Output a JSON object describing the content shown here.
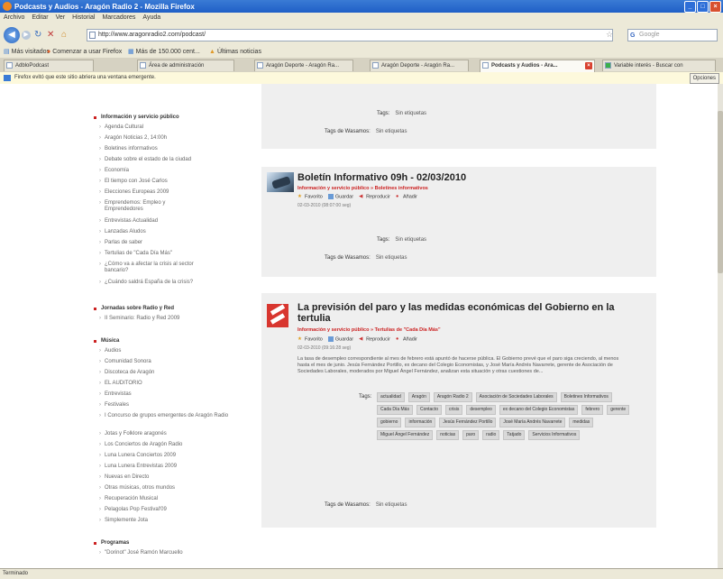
{
  "window": {
    "title": "Podcasts y Audios - Aragón Radio 2 - Mozilla Firefox"
  },
  "menubar": {
    "items": [
      "Archivo",
      "Editar",
      "Ver",
      "Historial",
      "Marcadores",
      "Ayuda"
    ]
  },
  "navbar": {
    "url": "http://www.aragonradio2.com/podcast/",
    "search_placeholder": "Google"
  },
  "bookmarks": {
    "items": [
      "Más visitados",
      "Comenzar a usar Firefox",
      "Más de 150.000 cent...",
      "Últimas noticias"
    ]
  },
  "tabs": [
    {
      "label": "AdbloPodcast"
    },
    {
      "label": "Área de administración"
    },
    {
      "label": "Aragón Deporte - Aragón Ra..."
    },
    {
      "label": "Aragón Deporte - Aragón Ra..."
    },
    {
      "label": "Podcasts y Audios - Ara...",
      "active": true
    },
    {
      "label": "Variable interés - Buscar con"
    }
  ],
  "infobar": {
    "message": "Firefox evitó que este sitio abriera una ventana emergente.",
    "button": "Opciones"
  },
  "sidebar": {
    "sections": [
      {
        "title": "Información y servicio público",
        "items": [
          "Agenda Cultural",
          "Aragón Noticias 2, 14:00h",
          "Boletines informativos",
          "Debate sobre el estado de la ciudad",
          "Economía",
          "El tiempo con José Carlos",
          "Elecciones Europeas 2009",
          "Emprendemos: Empleo y Emprendedores",
          "Entrevistas Actualidad",
          "Lanzadas Aludos",
          "Parlas de saber",
          "Tertulias de \"Cada Día Más\"",
          "¿Cómo va a afectar la crisis al sector bancario?",
          "¿Cuándo saldrá España de la crisis?"
        ]
      },
      {
        "title": "Jornadas sobre Radio y Red",
        "items": [
          "II Seminario: Radio y Red 2009"
        ]
      },
      {
        "title": "Música",
        "items": [
          "Audios",
          "Comunidad Sonora",
          "Discoteca de Aragón",
          "EL AUDITORIO",
          "Entrevistas",
          "Festivales",
          "I Concurso de grupos emergentes de Aragón Radio",
          "Jotas y Folklore aragonés",
          "Los Conciertos de Aragón Radio",
          "Luna Lunera Conciertos 2009",
          "Luna Lunera Entrevistas 2009",
          "Nuevas en Directo",
          "Otras músicas, otros mundos",
          "Recuperación Musical",
          "Pelagolas Pop Festival'09",
          "Simplemente Jota"
        ]
      },
      {
        "title": "Programas",
        "items": [
          "\"Dorinot\" José Ramón Marcuello"
        ]
      }
    ]
  },
  "content": {
    "top_block": {
      "tags_label": "Tags:",
      "tags_value": "Sin etiquetas",
      "tags2_label": "Tags de Wasamos:",
      "tags2_value": "Sin etiquetas"
    },
    "articles": [
      {
        "title": "Boletín Informativo 09h - 02/03/2010",
        "breadcrumb": "Información y servicio público » Boletines informativos",
        "actions": [
          "Favorito",
          "Guardar",
          "Reproducir",
          "Añadir"
        ],
        "date": "02-03-2010 (08:07:00 seg)",
        "tags_label": "Tags:",
        "tags_value": "Sin etiquetas",
        "tags2_label": "Tags de Wasamos:",
        "tags2_value": "Sin etiquetas"
      },
      {
        "title": "La previsión del paro y las medidas económicas del Gobierno en la tertulia",
        "breadcrumb": "Información y servicio público » Tertulias de \"Cada Día Más\"",
        "actions": [
          "Favorito",
          "Guardar",
          "Reproducir",
          "Añadir"
        ],
        "date": "02-03-2010 (09:16:28 seg)",
        "description": "La tasa de desempleo correspondiente al mes de febrero está apuntó de hacerse pública. El Gobierno prevé que el paro siga creciendo, al menos hasta el mes de junio. Jesús Fernández Portillo, ex decano del Colegio Economistas, y José María Andrés Navarrete, gerente de Asociación de Sociedades Laborales, moderados por Miguel Ángel Fernández, analizan esta situación y otras cuestiones de...",
        "tags_label": "Tags:",
        "tags": [
          "actualidad",
          "Aragón",
          "Aragón Radio 2",
          "Asociación de Sociedades Laborales",
          "Boletines Informativos",
          "Cada Día Más",
          "Contacto",
          "crisis",
          "desempleo",
          "ex decano del Colegio Economistas",
          "febrero",
          "gerente",
          "gobierno",
          "información",
          "Jesús Fernández Portillo",
          "José María Andrés Navarrete",
          "medidas",
          "Miguel Ángel Fernández",
          "noticias",
          "paro",
          "radio",
          "Tatjado",
          "Servicios Informativos"
        ],
        "tags2_label": "Tags de Wasamos:",
        "tags2_value": "Sin etiquetas"
      }
    ]
  },
  "statusbar": {
    "text": "Terminado"
  }
}
